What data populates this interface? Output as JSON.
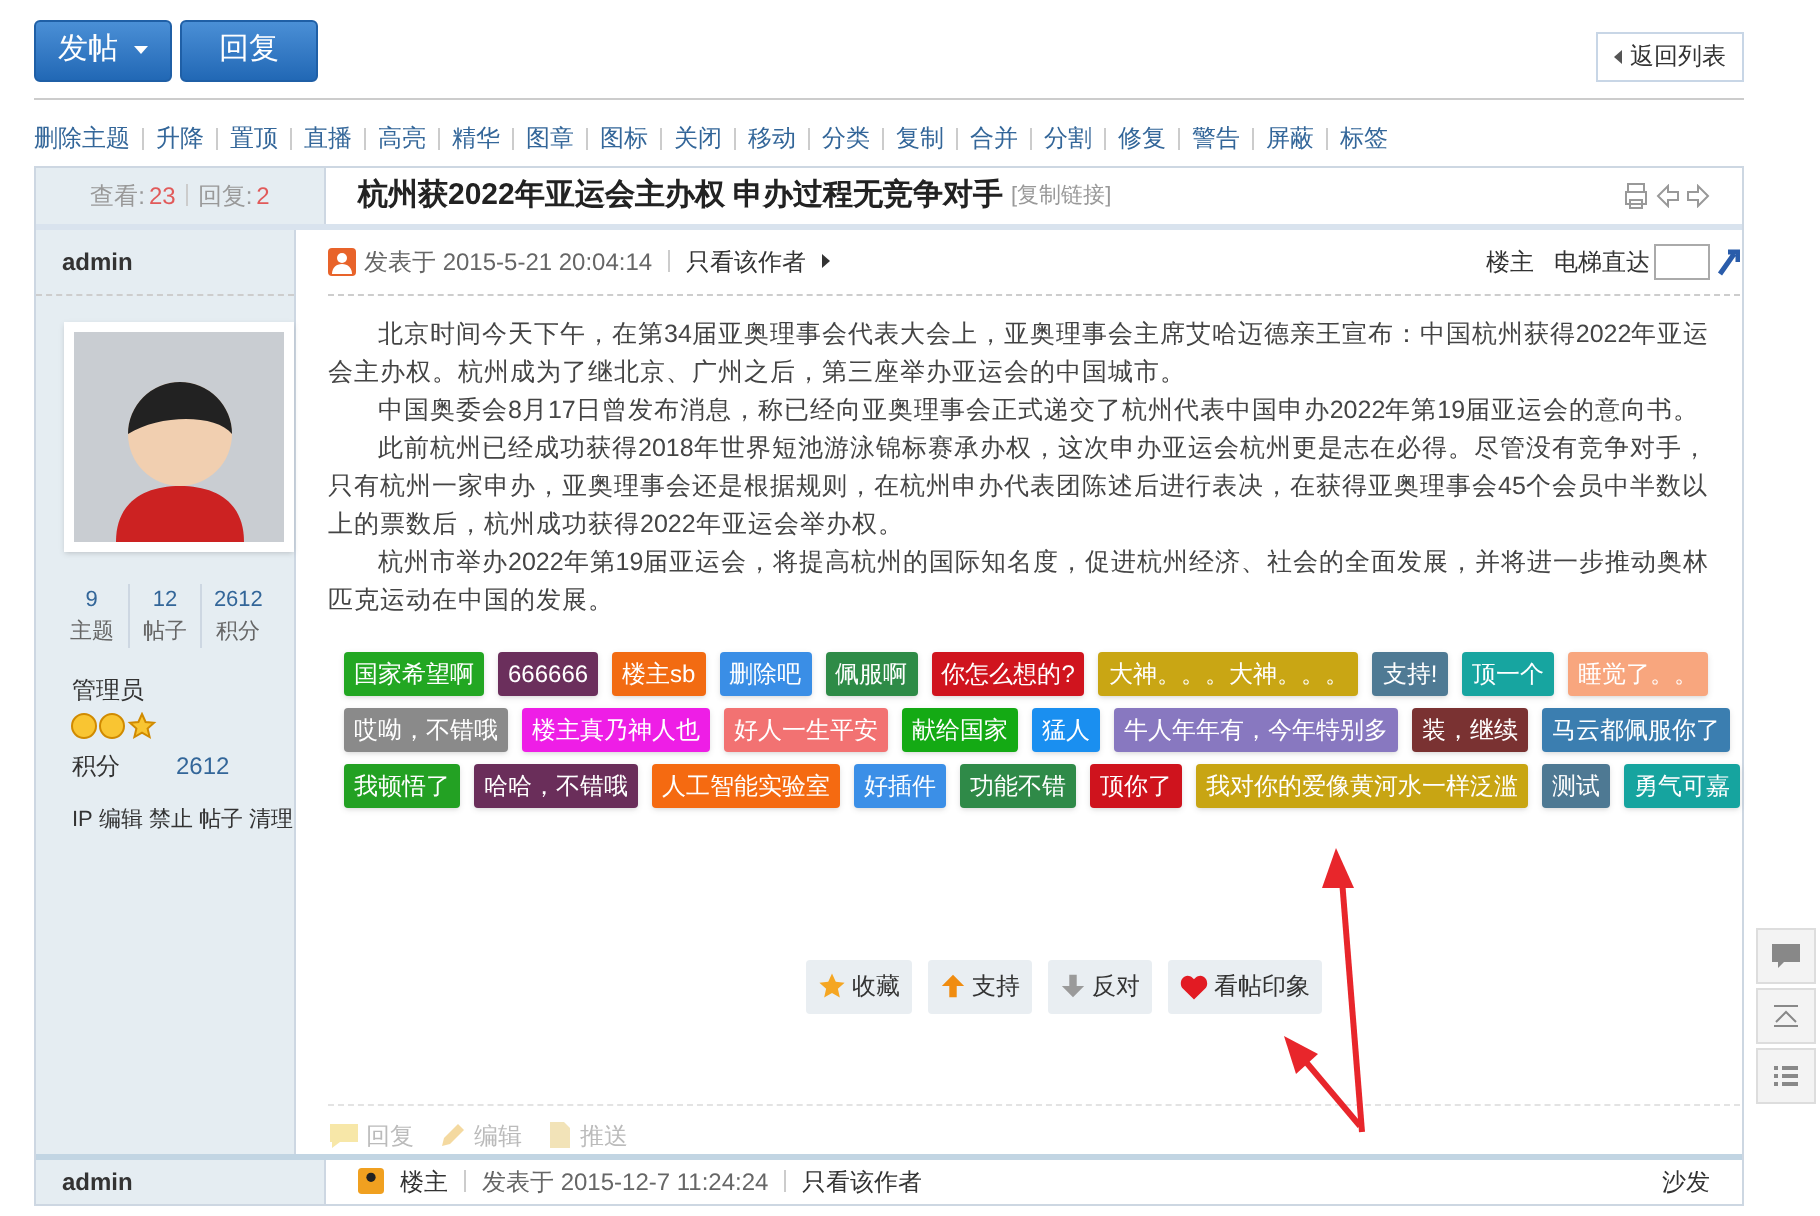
{
  "top_buttons": [
    {
      "label": "发帖",
      "dropdown": true
    },
    {
      "label": "回复",
      "dropdown": false
    }
  ],
  "back_button": "返回列表",
  "mod_tools": [
    "删除主题",
    "升降",
    "置顶",
    "直播",
    "高亮",
    "精华",
    "图章",
    "图标",
    "关闭",
    "移动",
    "分类",
    "复制",
    "合并",
    "分割",
    "修复",
    "警告",
    "屏蔽",
    "标签"
  ],
  "thread_stats": {
    "views_label": "查看:",
    "views": "23",
    "replies_label": "回复:",
    "replies": "2"
  },
  "post": {
    "title": "杭州获2022年亚运会主办权 申办过程无竞争对手",
    "copy_link": "[复制链接]",
    "author": "admin",
    "posted": "发表于 2015-5-21 20:04:14",
    "only_author": "只看该作者",
    "floor": "楼主",
    "jump_label": "电梯直达",
    "paragraphs": [
      "北京时间今天下午，在第34届亚奥理事会代表大会上，亚奥理事会主席艾哈迈德亲王宣布：中国杭州获得2022年亚运会主办权。杭州成为了继北京、广州之后，第三座举办亚运会的中国城市。",
      "中国奥委会8月17日曾发布消息，称已经向亚奥理事会正式递交了杭州代表中国申办2022年第19届亚运会的意向书。",
      "此前杭州已经成功获得2018年世界短池游泳锦标赛承办权，这次申办亚运会杭州更是志在必得。尽管没有竞争对手，只有杭州一家申办，亚奥理事会还是根据规则，在杭州申办代表团陈述后进行表决，在获得亚奥理事会45个会员中半数以上的票数后，杭州成功获得2022年亚运会举办权。",
      "杭州市举办2022年第19届亚运会，将提高杭州的国际知名度，促进杭州经济、社会的全面发展，并将进一步推动奥林匹克运动在中国的发展。"
    ],
    "tag_rows": [
      [
        {
          "label": "国家希望啊",
          "color": "#22a722"
        },
        {
          "label": "666666",
          "color": "#6b2f5c"
        },
        {
          "label": "楼主sb",
          "color": "#f26b12"
        },
        {
          "label": "删除吧",
          "color": "#3a8ee6"
        },
        {
          "label": "佩服啊",
          "color": "#2e8b47"
        },
        {
          "label": "你怎么想的?",
          "color": "#d0141e"
        },
        {
          "label": "大神。。。大神。。。",
          "color": "#c9a614"
        },
        {
          "label": "支持!",
          "color": "#4f7a94"
        },
        {
          "label": "顶一个",
          "color": "#17a5a0"
        },
        {
          "label": "睡觉了。。",
          "color": "#f8a67e"
        }
      ],
      [
        {
          "label": "哎呦，不错哦",
          "color": "#8a8a8a"
        },
        {
          "label": "楼主真乃神人也",
          "color": "#ee1ee6"
        },
        {
          "label": "好人一生平安",
          "color": "#f27272"
        },
        {
          "label": "献给国家",
          "color": "#14aa14"
        },
        {
          "label": "猛人",
          "color": "#1a8ff0"
        },
        {
          "label": "牛人年年有，今年特别多",
          "color": "#8878c0"
        },
        {
          "label": "装，继续",
          "color": "#7a3232"
        },
        {
          "label": "马云都佩服你了",
          "color": "#3b7eb0"
        }
      ],
      [
        {
          "label": "我顿悟了",
          "color": "#23a123"
        },
        {
          "label": "哈哈，不错哦",
          "color": "#6a2e5a"
        },
        {
          "label": "人工智能实验室",
          "color": "#f56a11"
        },
        {
          "label": "好插件",
          "color": "#3b8fe7"
        },
        {
          "label": "功能不错",
          "color": "#2f8a48"
        },
        {
          "label": "顶你了",
          "color": "#cf131d"
        },
        {
          "label": "我对你的爱像黄河水一样泛滥",
          "color": "#c8a513"
        },
        {
          "label": "测试",
          "color": "#4e7993"
        },
        {
          "label": "勇气可嘉",
          "color": "#16a49f"
        }
      ]
    ],
    "actions": [
      {
        "kind": "favorite",
        "label": "收藏"
      },
      {
        "kind": "support",
        "label": "支持"
      },
      {
        "kind": "oppose",
        "label": "反对"
      },
      {
        "kind": "impression",
        "label": "看帖印象"
      }
    ],
    "footer_actions": [
      {
        "kind": "reply",
        "label": "回复"
      },
      {
        "kind": "edit",
        "label": "编辑"
      },
      {
        "kind": "push",
        "label": "推送"
      }
    ]
  },
  "profile": {
    "stats": [
      {
        "value": "9",
        "label": "主题"
      },
      {
        "value": "12",
        "label": "帖子"
      },
      {
        "value": "2612",
        "label": "积分"
      }
    ],
    "group": "管理员",
    "points_label": "积分",
    "points": "2612",
    "admin_links": [
      "IP",
      "编辑",
      "禁止",
      "帖子",
      "清理"
    ]
  },
  "next_post": {
    "author": "admin",
    "floor": "楼主",
    "posted": "发表于 2015-12-7 11:24:24",
    "only_author": "只看该作者",
    "position": "沙发"
  }
}
